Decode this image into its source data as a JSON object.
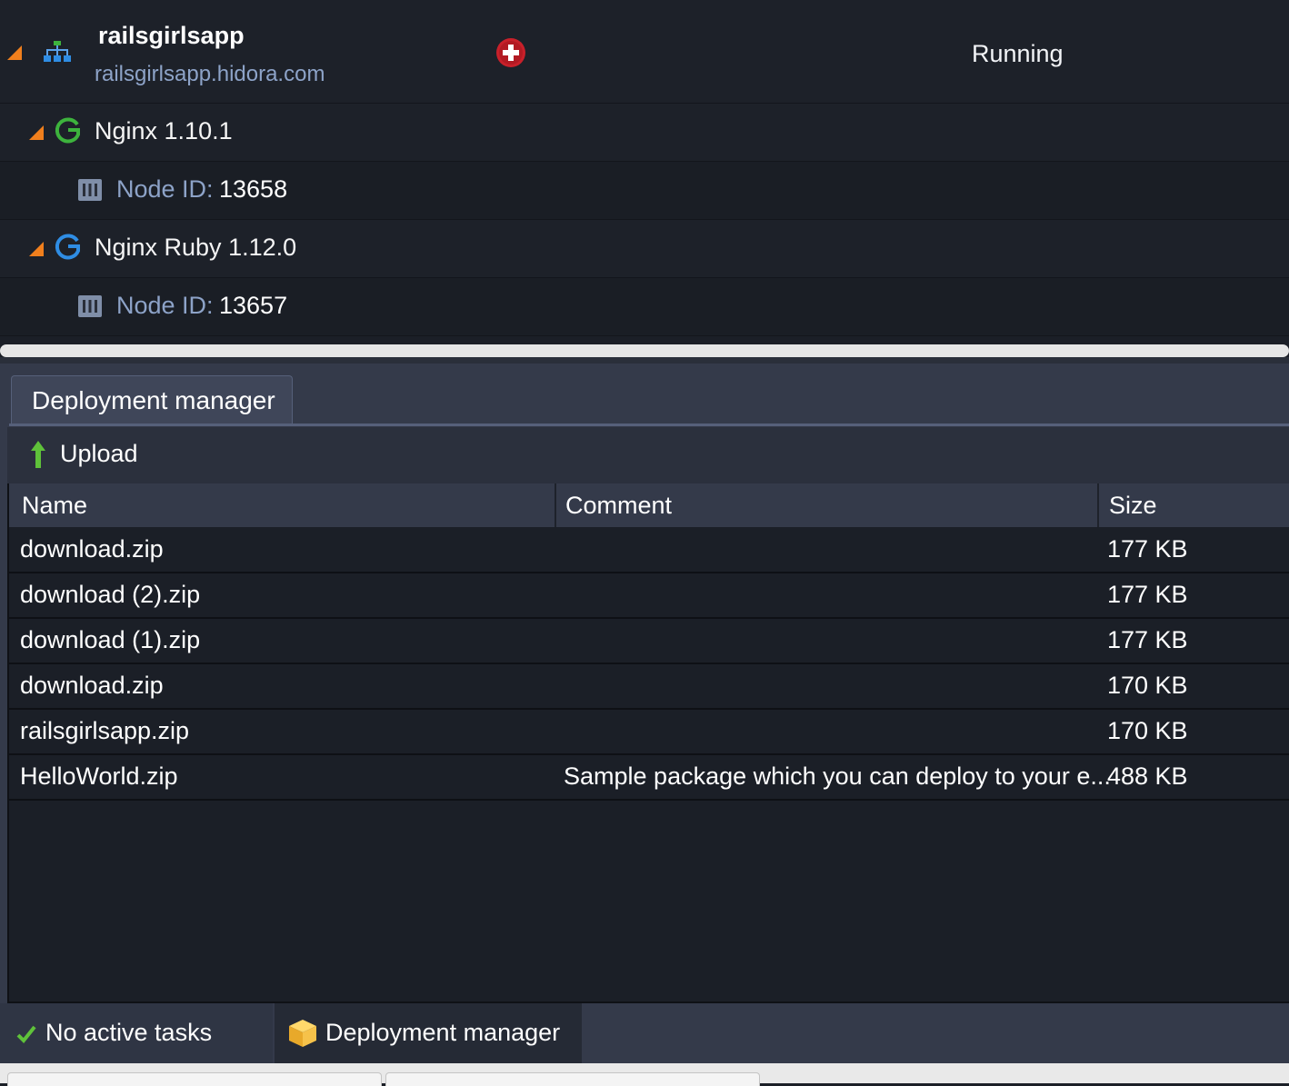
{
  "environment": {
    "name": "railsgirlsapp",
    "domain": "railsgirlsapp.hidora.com",
    "status": "Running"
  },
  "nodes": [
    {
      "name": "Nginx 1.10.1",
      "icon": "nginx-green-icon",
      "color": "#3db33d",
      "node_label": "Node ID:",
      "node_id": "13658"
    },
    {
      "name": "Nginx Ruby 1.12.0",
      "icon": "nginx-blue-icon",
      "color": "#2f8de4",
      "node_label": "Node ID:",
      "node_id": "13657"
    }
  ],
  "deployment": {
    "tab_label": "Deployment manager",
    "upload_label": "Upload",
    "columns": [
      "Name",
      "Comment",
      "Size"
    ],
    "rows": [
      {
        "name": "download.zip",
        "comment": "",
        "size": "177 KB"
      },
      {
        "name": "download (2).zip",
        "comment": "",
        "size": "177 KB"
      },
      {
        "name": "download (1).zip",
        "comment": "",
        "size": "177 KB"
      },
      {
        "name": "download.zip",
        "comment": "",
        "size": "170 KB"
      },
      {
        "name": "railsgirlsapp.zip",
        "comment": "",
        "size": "170 KB"
      },
      {
        "name": "HelloWorld.zip",
        "comment": "Sample package which you can deploy to your e...",
        "size": "488 KB"
      }
    ]
  },
  "tasks": {
    "status_label": "No active tasks",
    "active_panel_label": "Deployment manager"
  },
  "colors": {
    "accent_orange": "#f07f1d",
    "link_blue": "#8da3c8",
    "add_red": "#c8202a",
    "check_green": "#5fc23a"
  }
}
